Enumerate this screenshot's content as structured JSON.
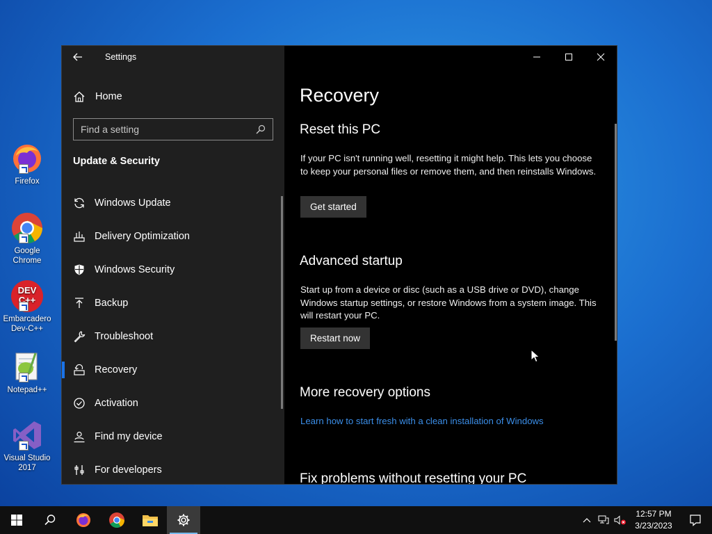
{
  "desktop": {
    "icons": [
      {
        "label": "Firefox",
        "icon": "firefox-icon"
      },
      {
        "label": "Google Chrome",
        "icon": "chrome-icon"
      },
      {
        "label": "Embarcadero Dev-C++",
        "icon": "devcpp-icon"
      },
      {
        "label": "Notepad++",
        "icon": "notepadpp-icon"
      },
      {
        "label": "Visual Studio 2017",
        "icon": "visual-studio-icon"
      }
    ],
    "devcpp_badge": "DEV C++"
  },
  "window": {
    "title": "Settings",
    "home_label": "Home",
    "search_placeholder": "Find a setting",
    "section_title": "Update & Security",
    "nav_items": [
      {
        "label": "Windows Update",
        "icon": "refresh-icon"
      },
      {
        "label": "Delivery Optimization",
        "icon": "delivery-optimization-icon"
      },
      {
        "label": "Windows Security",
        "icon": "shield-icon"
      },
      {
        "label": "Backup",
        "icon": "upload-arrow-icon"
      },
      {
        "label": "Troubleshoot",
        "icon": "wrench-icon"
      },
      {
        "label": "Recovery",
        "icon": "recovery-icon",
        "active": true
      },
      {
        "label": "Activation",
        "icon": "check-circle-icon"
      },
      {
        "label": "Find my device",
        "icon": "person-pin-icon"
      },
      {
        "label": "For developers",
        "icon": "developer-tools-icon"
      }
    ],
    "controls": {
      "minimize": "—",
      "maximize": "☐",
      "close": "✕"
    }
  },
  "content": {
    "page_title": "Recovery",
    "reset": {
      "heading": "Reset this PC",
      "text": "If your PC isn't running well, resetting it might help. This lets you choose to keep your personal files or remove them, and then reinstalls Windows.",
      "button": "Get started"
    },
    "advanced": {
      "heading": "Advanced startup",
      "text": "Start up from a device or disc (such as a USB drive or DVD), change Windows startup settings, or restore Windows from a system image. This will restart your PC.",
      "button": "Restart now"
    },
    "more": {
      "heading": "More recovery options",
      "link": "Learn how to start fresh with a clean installation of Windows"
    },
    "fix": {
      "heading": "Fix problems without resetting your PC"
    }
  },
  "taskbar": {
    "time": "12:57 PM",
    "date": "3/23/2023",
    "tray_chevron": "^"
  },
  "colors": {
    "accent": "#1a73e8",
    "link": "#3b8ee8",
    "nav_bg": "#1f1f1f",
    "content_bg": "#000000",
    "button_bg": "#333333"
  }
}
